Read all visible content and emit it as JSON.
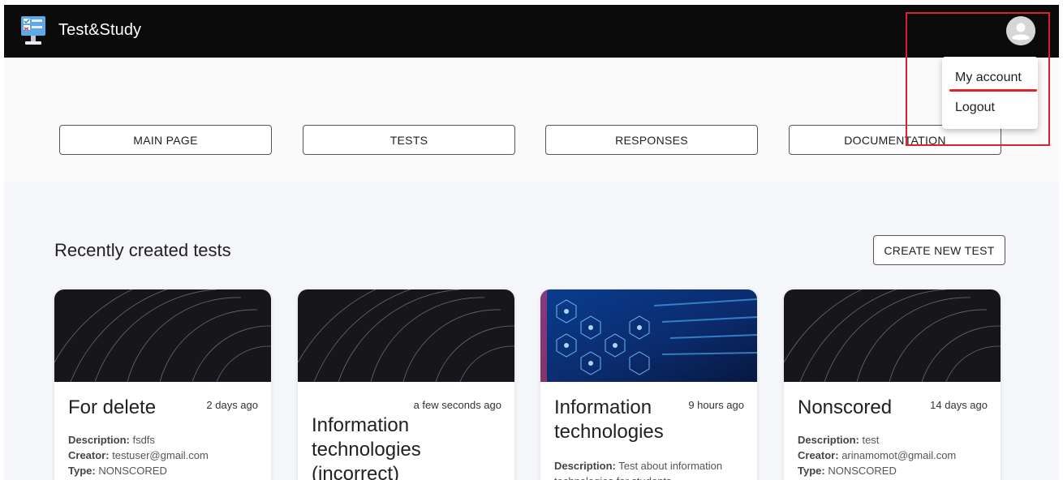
{
  "app": {
    "title": "Test&Study"
  },
  "nav": {
    "items": [
      {
        "label": "MAIN PAGE"
      },
      {
        "label": "TESTS"
      },
      {
        "label": "RESPONSES"
      },
      {
        "label": "DOCUMENTATION"
      }
    ]
  },
  "menu": {
    "items": [
      {
        "label": "My account"
      },
      {
        "label": "Logout"
      }
    ]
  },
  "content": {
    "section_title": "Recently created tests",
    "create_button": "CREATE NEW TEST"
  },
  "cards": [
    {
      "title": "For delete",
      "time": "2 days ago",
      "description_label": "Description:",
      "description": " fsdfs",
      "creator_label": "Creator:",
      "creator": " testuser@gmail.com",
      "type_label": "Type:",
      "type": " NONSCORED"
    },
    {
      "title": "Information technologies (incorrect)",
      "time": "a few seconds ago"
    },
    {
      "title": "Information technologies",
      "time": "9 hours ago",
      "description_label": "Description:",
      "description": " Test about information technologies for students"
    },
    {
      "title": "Nonscored",
      "time": "14 days ago",
      "description_label": "Description:",
      "description": " test",
      "creator_label": "Creator:",
      "creator": " arinamomot@gmail.com",
      "type_label": "Type:",
      "type": " NONSCORED"
    }
  ],
  "colors": {
    "appbar": "#0b0b0b",
    "highlight": "#e0202a",
    "background": "#f5f6f9"
  },
  "icons": {
    "logo": "computer-monitor-icon",
    "avatar": "account-circle-icon"
  }
}
